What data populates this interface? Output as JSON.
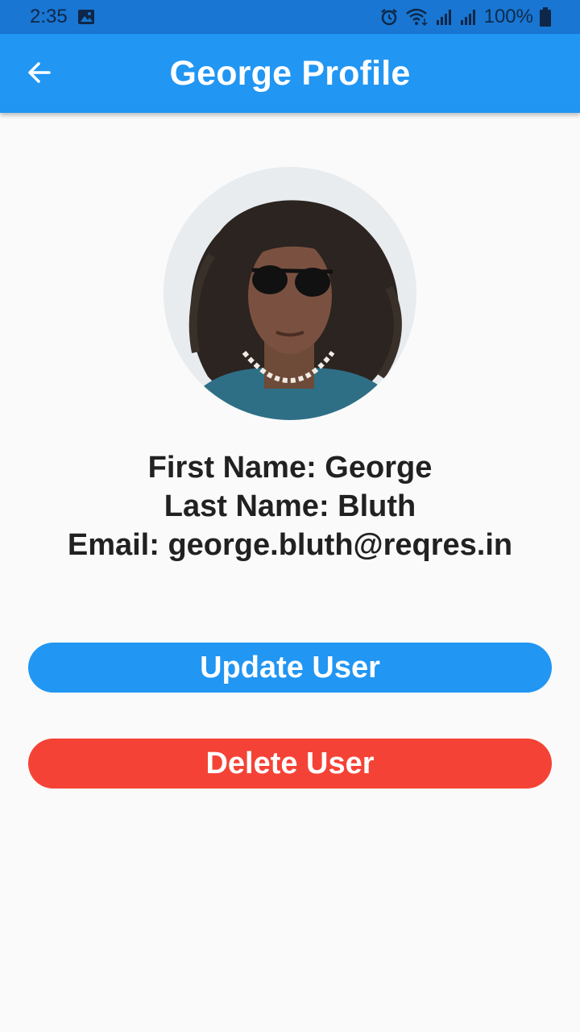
{
  "status_bar": {
    "time": "2:35",
    "battery_text": "100%",
    "icons": [
      "image-icon",
      "alarm-icon",
      "wifi-icon",
      "signal-icon",
      "signal-icon",
      "battery-icon"
    ]
  },
  "app_bar": {
    "title": "George Profile",
    "back_icon": "arrow-back-icon",
    "color": "#2196f3"
  },
  "profile": {
    "avatar": "avatar-photo",
    "first_name_line": "First Name: George",
    "last_name_line": "Last Name: Bluth",
    "email_line": "Email: george.bluth@reqres.in"
  },
  "actions": {
    "update_label": "Update User",
    "update_color": "#2196f3",
    "delete_label": "Delete User",
    "delete_color": "#f44336"
  }
}
